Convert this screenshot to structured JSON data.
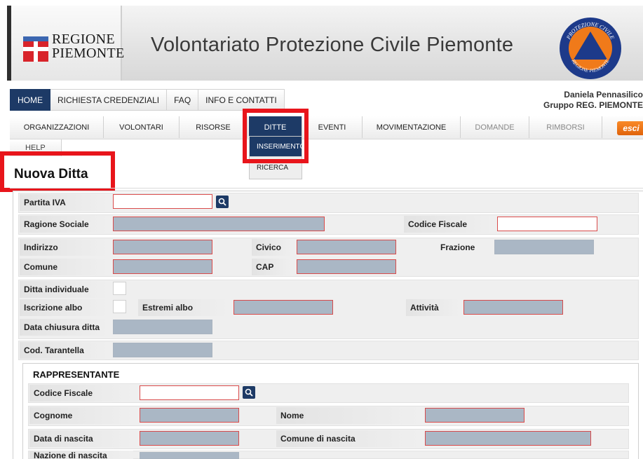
{
  "header": {
    "logo_line1": "REGIONE",
    "logo_line2": "PIEMONTE",
    "logo_icon": "piemonte-flag-icon",
    "site_title": "Volontariato Protezione Civile Piemonte",
    "seal_icon": "protezione-civile-seal-icon",
    "seal_text_top": "PROTEZIONE CIVILE",
    "seal_text_bottom": "REGIONE PIEMONTE"
  },
  "topnav": {
    "tabs": [
      {
        "label": "HOME",
        "active": true
      },
      {
        "label": "RICHIESTA CREDENZIALI",
        "active": false
      },
      {
        "label": "FAQ",
        "active": false
      },
      {
        "label": "INFO E CONTATTI",
        "active": false
      }
    ]
  },
  "user": {
    "name": "Daniela Pennasilico",
    "group": "Gruppo REG. PIEMONTE"
  },
  "menu": {
    "items": [
      {
        "label": "ORGANIZZAZIONI"
      },
      {
        "label": "VOLONTARI"
      },
      {
        "label": "RISORSE"
      },
      {
        "label": "DITTE",
        "active": true
      },
      {
        "label": "EVENTI"
      },
      {
        "label": "MOVIMENTAZIONE"
      },
      {
        "label": "DOMANDE",
        "disabled": true
      },
      {
        "label": "RIMBORSI",
        "disabled": true
      }
    ],
    "help": "HELP",
    "esci": "esci",
    "submenu": [
      {
        "label": "INSERIMENTO",
        "active": true
      },
      {
        "label": "RICERCA"
      }
    ]
  },
  "page": {
    "title": "Nuova Ditta"
  },
  "form": {
    "partita_iva": "Partita IVA",
    "ragione_sociale": "Ragione Sociale",
    "codice_fiscale": "Codice Fiscale",
    "indirizzo": "Indirizzo",
    "civico": "Civico",
    "frazione": "Frazione",
    "comune": "Comune",
    "cap": "CAP",
    "ditta_individuale": "Ditta individuale",
    "iscrizione_albo": "Iscrizione albo",
    "estremi_albo": "Estremi albo",
    "attivita": "Attività",
    "data_chiusura": "Data chiusura ditta",
    "cod_tarantella": "Cod. Tarantella"
  },
  "rappresentante": {
    "title": "RAPPRESENTANTE",
    "codice_fiscale": "Codice Fiscale",
    "cognome": "Cognome",
    "nome": "Nome",
    "data_nascita": "Data di nascita",
    "comune_nascita": "Comune di nascita",
    "nazione_nascita": "Nazione di nascita"
  },
  "colors": {
    "nav_active": "#1d3a66",
    "highlight_red": "#e8151b",
    "field_fill": "#aab7c5",
    "field_border": "#d94b4b",
    "esci_orange": "#f07a1a"
  }
}
